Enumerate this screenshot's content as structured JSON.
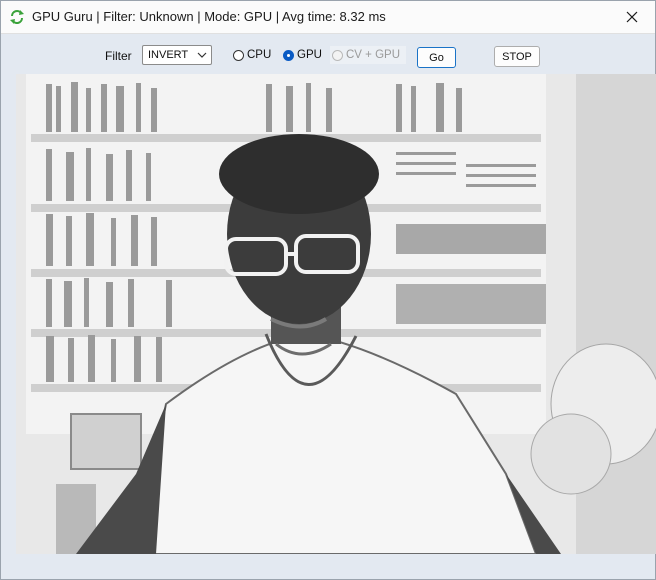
{
  "window": {
    "title": "GPU Guru | Filter: Unknown | Mode: GPU | Avg time: 8.32 ms",
    "icon": "refresh-arrows-icon",
    "close_icon": "close-icon"
  },
  "toolbar": {
    "filter_label": "Filter",
    "filter_select": {
      "value": "INVERT"
    },
    "modes": [
      {
        "label": "CPU",
        "checked": false,
        "enabled": true
      },
      {
        "label": "GPU",
        "checked": true,
        "enabled": true
      },
      {
        "label": "CV + GPU",
        "checked": false,
        "enabled": false
      }
    ],
    "go_label": "Go",
    "stop_label": "STOP"
  },
  "video": {
    "description_icon": "camera-feed",
    "accent": "#1a73c7"
  }
}
